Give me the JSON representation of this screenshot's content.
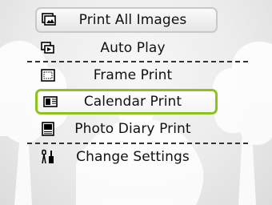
{
  "menu": {
    "items": [
      {
        "label": "Print All Images",
        "icon": "print-all-images-icon"
      },
      {
        "label": "Auto Play",
        "icon": "auto-play-icon"
      },
      {
        "label": "Frame Print",
        "icon": "frame-print-icon"
      },
      {
        "label": "Calendar Print",
        "icon": "calendar-print-icon"
      },
      {
        "label": "Photo Diary Print",
        "icon": "photo-diary-print-icon"
      },
      {
        "label": "Change Settings",
        "icon": "change-settings-icon"
      }
    ],
    "selected": "Calendar Print"
  },
  "colors": {
    "selection_border": "#8fc21f",
    "text": "#111111",
    "background": "#ececec"
  }
}
